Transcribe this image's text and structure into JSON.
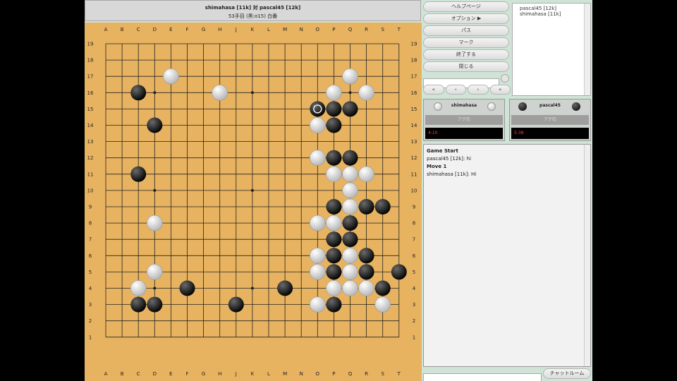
{
  "header": {
    "players_line": "shimahasa [11k] 対 pascal45 [12k]",
    "move_line": "53手目 (黒:o15) 白番"
  },
  "buttons": {
    "help": "ヘルプページ",
    "options": "オプション ▶",
    "pass": "パス",
    "mark": "マーク",
    "done": "終了する",
    "close": "閉じる"
  },
  "nav": [
    "«",
    "‹",
    "›",
    "»"
  ],
  "players_list": [
    "pascal45 [12k]",
    "shimahasa [11k]"
  ],
  "white_player": {
    "name": "shimahasa",
    "captures": "アゲ石",
    "time": "4:10"
  },
  "black_player": {
    "name": "pascal45",
    "captures": "アゲ石",
    "time": "5:38"
  },
  "log": [
    {
      "text": "Game Start",
      "bold": true
    },
    {
      "text": "pascal45 [12k]: hi",
      "bold": false
    },
    {
      "text": "Move 1",
      "bold": true
    },
    {
      "text": "shimahasa [11k]: Hi",
      "bold": false
    }
  ],
  "chat_button": "チャットルーム",
  "board": {
    "columns": [
      "A",
      "B",
      "C",
      "D",
      "E",
      "F",
      "G",
      "H",
      "J",
      "K",
      "L",
      "M",
      "N",
      "O",
      "P",
      "Q",
      "R",
      "S",
      "T"
    ],
    "rows": [
      "19",
      "18",
      "17",
      "16",
      "15",
      "14",
      "13",
      "12",
      "11",
      "10",
      "9",
      "8",
      "7",
      "6",
      "5",
      "4",
      "3",
      "2",
      "1"
    ],
    "last_move": "O15",
    "black_stones": [
      "C16",
      "D14",
      "C11",
      "O15",
      "P15",
      "Q15",
      "P14",
      "P12",
      "Q12",
      "P9",
      "R9",
      "S9",
      "Q8",
      "P7",
      "Q7",
      "P6",
      "R6",
      "P5",
      "R5",
      "T5",
      "F4",
      "M4",
      "S4",
      "C3",
      "D3",
      "J3",
      "P3"
    ],
    "white_stones": [
      "E17",
      "Q17",
      "H16",
      "P16",
      "R16",
      "O14",
      "O12",
      "P11",
      "Q11",
      "R11",
      "Q10",
      "Q9",
      "D8",
      "O8",
      "P8",
      "O6",
      "Q6",
      "D5",
      "O5",
      "Q5",
      "C4",
      "P4",
      "Q4",
      "R4",
      "O3",
      "S3"
    ]
  },
  "colors": {
    "board": "#e8b360",
    "panel": "#cfe4d6",
    "time_text": "#ff4040"
  }
}
